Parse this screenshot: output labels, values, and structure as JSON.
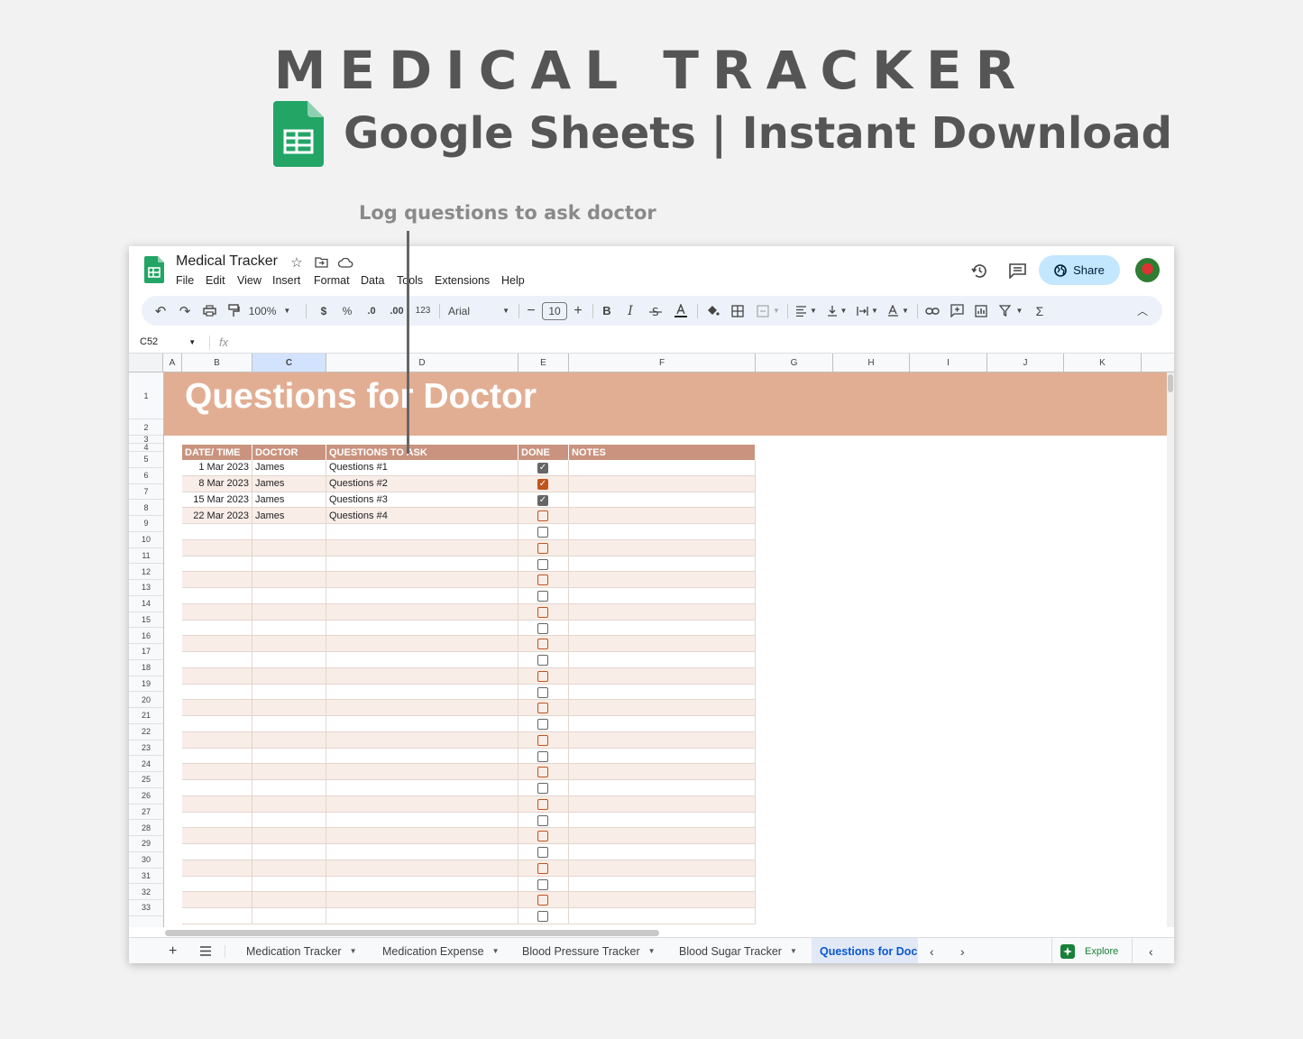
{
  "promo": {
    "title": "MEDICAL TRACKER",
    "subtitle": "Google Sheets | Instant Download",
    "callout": "Log questions to ask doctor"
  },
  "app": {
    "doc_title": "Medical Tracker",
    "menu": [
      "File",
      "Edit",
      "View",
      "Insert",
      "Format",
      "Data",
      "Tools",
      "Extensions",
      "Help"
    ],
    "share_label": "Share"
  },
  "toolbar": {
    "zoom": "100%",
    "currency": "$",
    "percent": "%",
    "dec_decrease": ".0",
    "dec_increase": ".00",
    "format_123": "123",
    "font": "Arial",
    "font_size": "10",
    "bold": "B",
    "italic": "I"
  },
  "formula_bar": {
    "cell_ref": "C52",
    "fx": "fx"
  },
  "grid": {
    "columns": [
      "A",
      "B",
      "C",
      "D",
      "E",
      "F",
      "G",
      "H",
      "I",
      "J",
      "K"
    ],
    "rows": [
      "1",
      "2",
      "3",
      "4",
      "5",
      "6",
      "7",
      "8",
      "9",
      "10",
      "11",
      "12",
      "13",
      "14",
      "15",
      "16",
      "17",
      "18",
      "19",
      "20",
      "21",
      "22",
      "23",
      "24",
      "25",
      "26",
      "27",
      "28",
      "29",
      "30",
      "31",
      "32",
      "33"
    ],
    "selected_column": "C"
  },
  "sheet": {
    "title": "Questions for Doctor",
    "headers": [
      "DATE/ TIME",
      "DOCTOR",
      "QUESTIONS TO ASK",
      "DONE",
      "NOTES"
    ],
    "entries": [
      {
        "date": "1 Mar 2023",
        "doctor": "James",
        "question": "Questions #1",
        "done": true
      },
      {
        "date": "8 Mar 2023",
        "doctor": "James",
        "question": "Questions #2",
        "done": true
      },
      {
        "date": "15 Mar 2023",
        "doctor": "James",
        "question": "Questions #3",
        "done": true
      },
      {
        "date": "22 Mar 2023",
        "doctor": "James",
        "question": "Questions #4",
        "done": false
      }
    ],
    "empty_rows": 25,
    "colors": {
      "banner": "#e2ae93",
      "header": "#c9937f",
      "alt_row": "#f9ede7",
      "checkbox_orange": "#c0561d"
    }
  },
  "tabs": {
    "items": [
      "Medication Tracker",
      "Medication Expense",
      "Blood Pressure Tracker",
      "Blood Sugar Tracker",
      "Questions for Doc"
    ],
    "active": "Questions for Doc",
    "explore_label": "Explore"
  }
}
